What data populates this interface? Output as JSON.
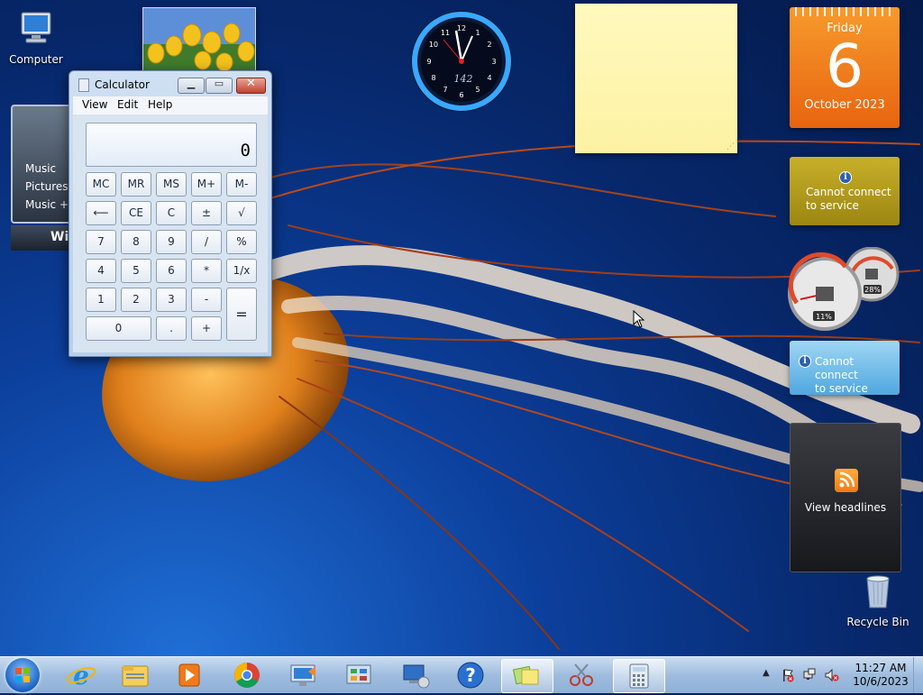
{
  "desktop": {
    "icons": [
      {
        "label": "Computer"
      },
      {
        "label": "Recycle Bin"
      }
    ]
  },
  "gadgets": {
    "clock": {
      "text": "142"
    },
    "calendar": {
      "weekday": "Friday",
      "day": "6",
      "month_year": "October 2023"
    },
    "weather": {
      "message_line1": "Cannot connect",
      "message_line2": "to service"
    },
    "cpu_meter": {
      "cpu": "11%",
      "memory": "28%"
    },
    "currency": {
      "message_line1": "Cannot connect",
      "message_line2": "to service"
    },
    "feed": {
      "label": "View headlines"
    },
    "media_center": {
      "items": [
        "Music",
        "Pictures",
        "Music +"
      ],
      "bar_label": "Wi"
    }
  },
  "calculator": {
    "title": "Calculator",
    "menu": [
      "View",
      "Edit",
      "Help"
    ],
    "display": "0",
    "keys": {
      "mc": "MC",
      "mr": "MR",
      "ms": "MS",
      "mplus": "M+",
      "mminus": "M-",
      "back": "⟵",
      "ce": "CE",
      "c": "C",
      "pm": "±",
      "sqrt": "√",
      "k7": "7",
      "k8": "8",
      "k9": "9",
      "div": "/",
      "pct": "%",
      "k4": "4",
      "k5": "5",
      "k6": "6",
      "mul": "*",
      "inv": "1/x",
      "k1": "1",
      "k2": "2",
      "k3": "3",
      "sub": "-",
      "eq": "=",
      "k0": "0",
      "dot": ".",
      "add": "+"
    }
  },
  "taskbar": {
    "clock_time": "11:27 AM",
    "clock_date": "10/6/2023"
  }
}
